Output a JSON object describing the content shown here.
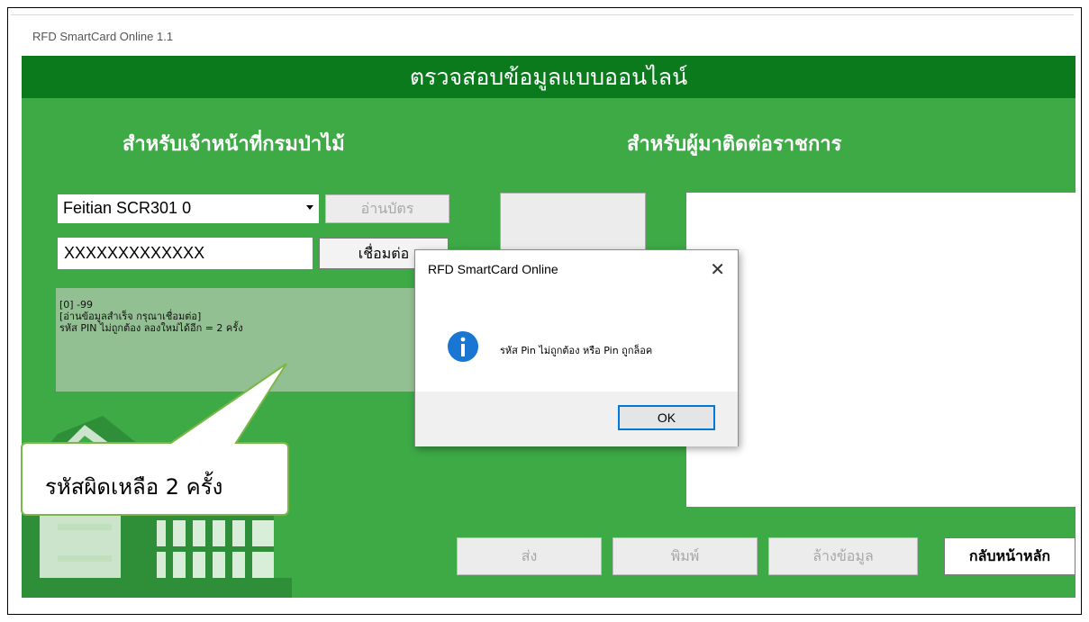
{
  "window": {
    "title": "RFD SmartCard Online 1.1"
  },
  "header": {
    "title": "ตรวจสอบข้อมูลแบบออนไลน์"
  },
  "left_section": {
    "heading": "สำหรับเจ้าหน้าที่กรมป่าไม้",
    "reader_select": {
      "value": "Feitian SCR301 0"
    },
    "read_card_label": "อ่านบัตร",
    "pin_input": {
      "value": "XXXXXXXXXXXXX"
    },
    "connect_label": "เชื่อมต่อ",
    "log_lines": [
      "[0] -99",
      "[อ่านข้อมูลสำเร็จ กรุณาเชื่อมต่อ]",
      "รหัส PIN ไม่ถูกต้อง ลองใหม่ได้อีก = 2 ครั้ง"
    ]
  },
  "right_section": {
    "heading": "สำหรับผู้มาติดต่อราชการ"
  },
  "bottom_buttons": {
    "send": "ส่ง",
    "print": "พิมพ์",
    "clear": "ล้างข้อมูล",
    "home": "กลับหน้าหลัก"
  },
  "dialog": {
    "title": "RFD SmartCard Online",
    "close_icon": "close-icon",
    "icon": "info-icon",
    "message": "รหัส Pin ไม่ถูกต้อง หรือ Pin ถูกล็อค",
    "ok_label": "OK"
  },
  "callout": {
    "text": "รหัสผิดเหลือ  2 ครั้ง"
  },
  "colors": {
    "header_green": "#0a7a1c",
    "panel_green": "#3daa46",
    "log_green": "#93c092",
    "dialog_accent": "#0078d7",
    "info_blue": "#1976d2"
  }
}
